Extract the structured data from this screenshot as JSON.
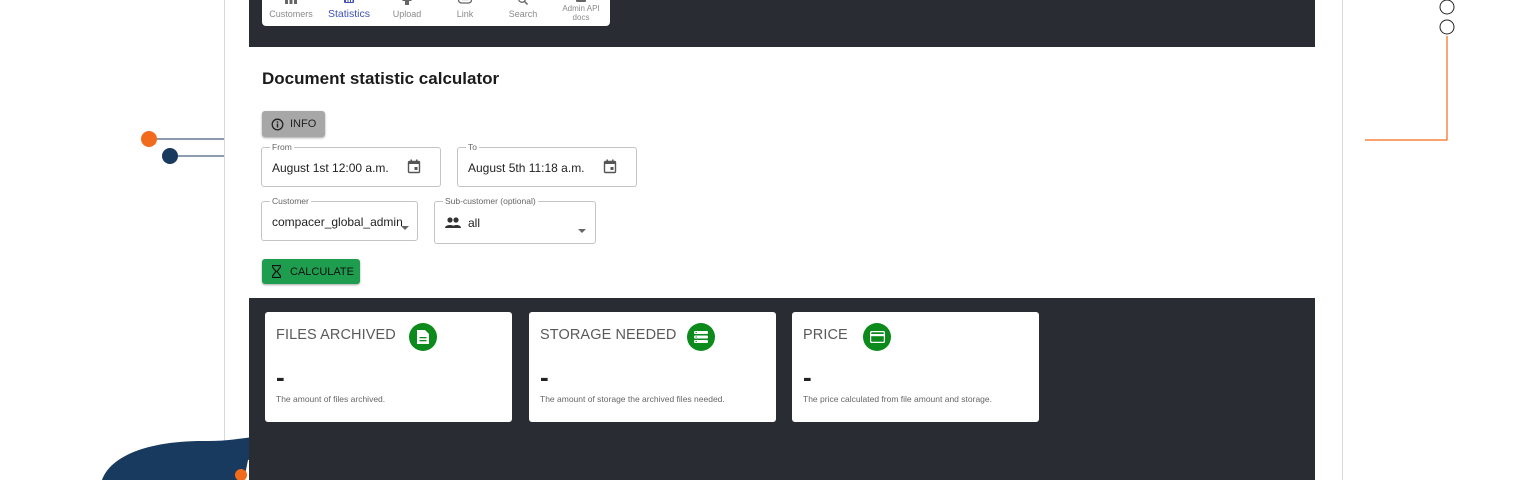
{
  "nav": {
    "items": [
      {
        "label": "Customers",
        "icon": "bar-chart-icon",
        "active": false
      },
      {
        "label": "Statistics",
        "icon": "statistics-icon",
        "active": true
      },
      {
        "label": "Upload",
        "icon": "upload-arrow-icon",
        "active": false
      },
      {
        "label": "Link",
        "icon": "link-icon",
        "active": false
      },
      {
        "label": "Search",
        "icon": "search-icon",
        "active": false
      },
      {
        "label": "Admin API docs",
        "icon": "docs-icon",
        "active": false
      }
    ]
  },
  "page": {
    "title": "Document statistic calculator",
    "info_button": "INFO",
    "calculate_button": "CALCULATE"
  },
  "form": {
    "from_label": "From",
    "from_value": "August 1st 12:00 a.m.",
    "to_label": "To",
    "to_value": "August 5th 11:18 a.m.",
    "customer_label": "Customer",
    "customer_value": "compacer_global_admin",
    "subcustomer_label": "Sub-customer (optional)",
    "subcustomer_value": "all"
  },
  "cards": [
    {
      "title": "FILES ARCHIVED",
      "value": "-",
      "description": "The amount of files archived.",
      "icon": "document-icon"
    },
    {
      "title": "STORAGE NEEDED",
      "value": "-",
      "description": "The amount of storage the archived files needed.",
      "icon": "storage-list-icon"
    },
    {
      "title": "PRICE",
      "value": "-",
      "description": "The price calculated from file amount and storage.",
      "icon": "credit-card-icon"
    }
  ],
  "colors": {
    "dark_band": "#2a2c33",
    "accent_orange": "#f26a1b",
    "accent_navy": "#173a5e",
    "calculate_green": "#1e9d4f",
    "card_icon_green": "#0d8a1c",
    "active_nav": "#3f51b5"
  }
}
